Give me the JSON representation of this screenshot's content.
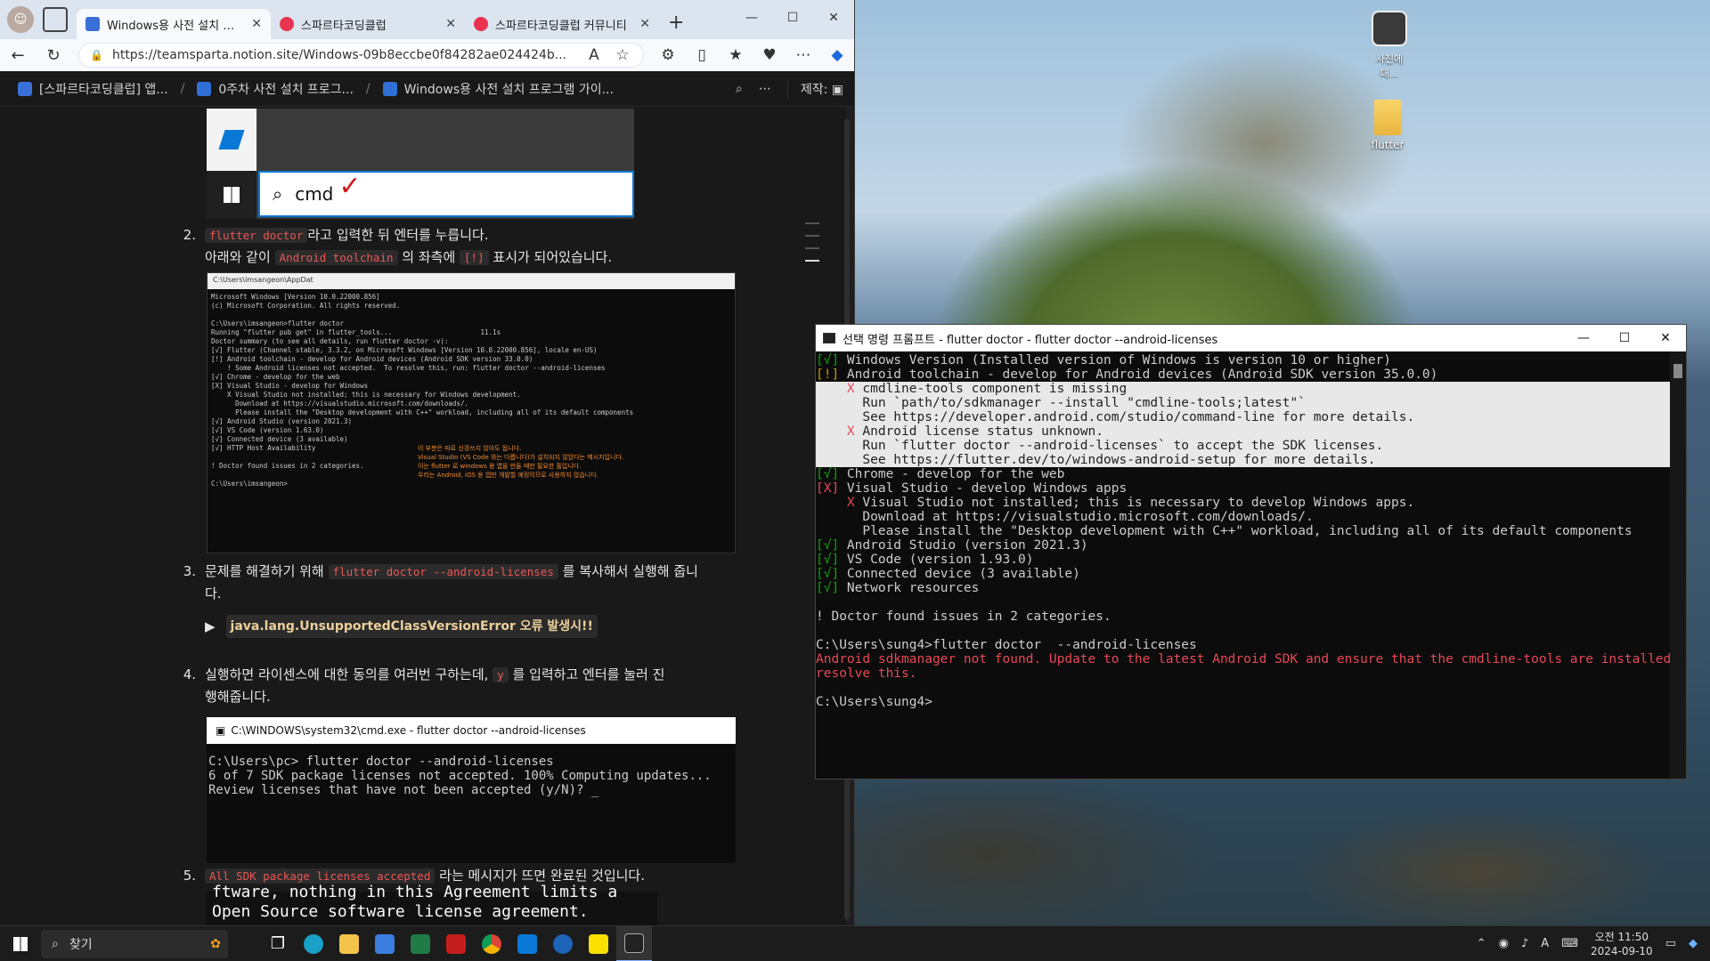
{
  "browser": {
    "tabs": [
      {
        "title": "Windows용 사전 설치 프로그",
        "active": true
      },
      {
        "title": "스파르타코딩클럽",
        "active": false
      },
      {
        "title": "스파르타코딩클럽 커뮤니티",
        "active": false
      }
    ],
    "url": "https://teamsparta.notion.site/Windows-09b8eccbe0f84282ae024424b...",
    "breadcrumbs": [
      "[스파르타코딩클럽] 앱...",
      "0주차 사전 설치 프로그...",
      "Windows용 사전 설치 프로그램 가이..."
    ],
    "maker_label": "제작:"
  },
  "page": {
    "shot1_search": "cmd",
    "step2": {
      "num": "2.",
      "code1": "flutter doctor",
      "text1": "라고 입력한 뒤 엔터를 누릅니다.",
      "text2a": "아래와 같이",
      "code2": "Android toolchain",
      "text2b": "의 좌측에",
      "code3": "[!]",
      "text2c": "표시가 되어있습니다."
    },
    "shot2_title": "C:\\Users\\imsangeon\\AppDat",
    "shot2_lines": "Microsoft Windows [Version 10.0.22000.856]\n(c) Microsoft Corporation. All rights reserved.\n\nC:\\Users\\imsangeon>flutter doctor\nRunning \"flutter pub get\" in flutter_tools...                      11.1s\nDoctor summary (to see all details, run flutter doctor -v):\n[√] Flutter (Channel stable, 3.3.2, on Microsoft Windows [Version 10.0.22000.856], locale en-US)\n[!] Android toolchain - develop for Android devices (Android SDK version 33.0.0)\n    ! Some Android licenses not accepted.  To resolve this, run: flutter doctor --android-licenses\n[√] Chrome - develop for the web\n[X] Visual Studio - develop for Windows\n    X Visual Studio not installed; this is necessary for Windows development.\n      Download at https://visualstudio.microsoft.com/downloads/.\n      Please install the \"Desktop development with C++\" workload, including all of its default components\n[√] Android Studio (version 2021.3)\n[√] VS Code (version 1.63.0)\n[√] Connected device (3 available)\n[√] HTTP Host Availability\n\n! Doctor found issues in 2 categories.\n\nC:\\Users\\imsangeon>",
    "shot2_note": "이 부분은 따로 신경쓰지 않아도 됩니다.\nVisual Studio (VS Code 와는 다릅니다)가 설치되지 않았다는 메시지입니다.\n이는 flutter 로 windows 용 앱을 만들 때만 필요한 툴입니다.\n우리는 Android, iOS 용 앱만 개발할 예정이므로 사용하지 않습니다.",
    "step3": {
      "num": "3.",
      "text1": "문제를 해결하기 위해",
      "code1": "flutter doctor --android-licenses",
      "text2": "를 복사해서 실행해 줍니",
      "text3": "다.",
      "toggle": "java.lang.UnsupportedClassVersionError 오류 발생시!!"
    },
    "step4": {
      "num": "4.",
      "text1": "실행하면 라이센스에 대한 동의를 여러번 구하는데,",
      "code1": "y",
      "text2": "를 입력하고 엔터를 눌러 진",
      "text3": "행해줍니다."
    },
    "shot3_title": "C:\\WINDOWS\\system32\\cmd.exe - flutter  doctor --android-licenses",
    "shot3_lines": "C:\\Users\\pc> flutter doctor --android-licenses\n6 of 7 SDK package licenses not accepted. 100% Computing updates...\nReview licenses that have not been accepted (y/N)? _",
    "step5": {
      "num": "5.",
      "code1": "All SDK package licenses accepted",
      "text1": "라는 메시지가 뜨면 완료된 것입니다."
    },
    "shot4_lines": "ftware, nothing in this Agreement limits a\nOpen Source software license agreement."
  },
  "terminal": {
    "title": "선택 명령 프롬프트 - flutter  doctor - flutter  doctor  --android-licenses",
    "lines": [
      {
        "pre": "[√]",
        "text": " Windows Version (Installed version of Windows is version 10 or higher)",
        "cls": "g",
        "sel": false
      },
      {
        "pre": "[!]",
        "text": " Android toolchain - develop for Android devices (Android SDK version 35.0.0)",
        "cls": "y",
        "sel": false
      },
      {
        "pre": "    X",
        "text": " cmdline-tools component is missing",
        "cls": "r",
        "sel": true
      },
      {
        "pre": "",
        "text": "      Run `path/to/sdkmanager --install \"cmdline-tools;latest\"`",
        "cls": "",
        "sel": true
      },
      {
        "pre": "",
        "text": "      See https://developer.android.com/studio/command-line for more details.",
        "cls": "",
        "sel": true
      },
      {
        "pre": "    X",
        "text": " Android license status unknown.",
        "cls": "r",
        "sel": true
      },
      {
        "pre": "",
        "text": "      Run `flutter doctor --android-licenses` to accept the SDK licenses.",
        "cls": "",
        "sel": true
      },
      {
        "pre": "",
        "text": "      See https://flutter.dev/to/windows-android-setup for more details.",
        "cls": "",
        "sel": true
      },
      {
        "pre": "[√]",
        "text": " Chrome - develop for the web",
        "cls": "g",
        "sel": false
      },
      {
        "pre": "[X]",
        "text": " Visual Studio - develop Windows apps",
        "cls": "r",
        "sel": false
      },
      {
        "pre": "    X",
        "text": " Visual Studio not installed; this is necessary to develop Windows apps.",
        "cls": "r",
        "sel": false
      },
      {
        "pre": "",
        "text": "      Download at https://visualstudio.microsoft.com/downloads/.",
        "cls": "",
        "sel": false
      },
      {
        "pre": "",
        "text": "      Please install the \"Desktop development with C++\" workload, including all of its default components",
        "cls": "",
        "sel": false
      },
      {
        "pre": "[√]",
        "text": " Android Studio (version 2021.3)",
        "cls": "g",
        "sel": false
      },
      {
        "pre": "[√]",
        "text": " VS Code (version 1.93.0)",
        "cls": "g",
        "sel": false
      },
      {
        "pre": "[√]",
        "text": " Connected device (3 available)",
        "cls": "g",
        "sel": false
      },
      {
        "pre": "[√]",
        "text": " Network resources",
        "cls": "g",
        "sel": false
      },
      {
        "pre": "",
        "text": "",
        "cls": "",
        "sel": false
      },
      {
        "pre": "",
        "text": "! Doctor found issues in 2 categories.",
        "cls": "",
        "sel": false
      },
      {
        "pre": "",
        "text": "",
        "cls": "",
        "sel": false
      },
      {
        "pre": "",
        "text": "C:\\Users\\sung4>flutter doctor  --android-licenses",
        "cls": "",
        "sel": false
      },
      {
        "pre": "",
        "text": "Android sdkmanager not found. Update to the latest Android SDK and ensure that the cmdline-tools are installed to",
        "cls": "err",
        "sel": false
      },
      {
        "pre": "",
        "text": "resolve this.",
        "cls": "err",
        "sel": false
      },
      {
        "pre": "",
        "text": "",
        "cls": "",
        "sel": false
      },
      {
        "pre": "",
        "text": "C:\\Users\\sung4>",
        "cls": "",
        "sel": false
      }
    ]
  },
  "desktop": {
    "folder_label": "flutter",
    "corner_label": "사진에\n대..."
  },
  "taskbar": {
    "search_placeholder": "찾기",
    "clock_time": "오전 11:50",
    "clock_date": "2024-09-10",
    "ime": "A",
    "apps": [
      "task-view-icon",
      "edge-icon",
      "file-explorer-icon",
      "store-icon",
      "excel-icon",
      "acrobat-icon",
      "chrome-icon",
      "vscode-icon",
      "bitwarden-icon",
      "kakaotalk-icon",
      "terminal-icon"
    ]
  },
  "colors": {
    "accent": "#0a78d7",
    "code_red": "#eb5757",
    "term_green": "#13a10e",
    "term_yellow": "#c19c00",
    "term_red": "#e74856"
  }
}
